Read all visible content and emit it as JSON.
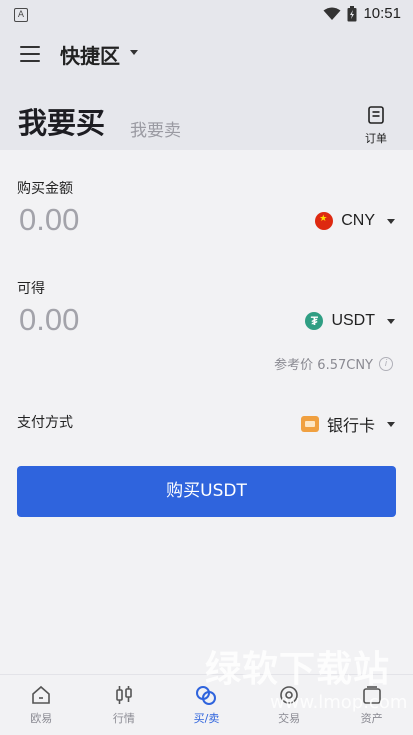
{
  "status_bar": {
    "time": "10:51"
  },
  "header": {
    "zone_title": "快捷区",
    "tabs": {
      "buy": "我要买",
      "sell": "我要卖"
    },
    "orders_label": "订单"
  },
  "form": {
    "purchase_amount": {
      "label": "购买金额",
      "value": "0.00",
      "currency": "CNY"
    },
    "receive": {
      "label": "可得",
      "value": "0.00",
      "currency": "USDT",
      "currency_symbol": "₮"
    },
    "reference_price": "参考价 6.57CNY",
    "payment": {
      "label": "支付方式",
      "method": "银行卡"
    },
    "submit_label": "购买USDT"
  },
  "bottom_nav": [
    {
      "label": "欧易",
      "icon": "home-icon",
      "active": false
    },
    {
      "label": "行情",
      "icon": "candlestick-icon",
      "active": false
    },
    {
      "label": "买/卖",
      "icon": "exchange-icon",
      "active": true
    },
    {
      "label": "交易",
      "icon": "trade-icon",
      "active": false
    },
    {
      "label": "资产",
      "icon": "wallet-icon",
      "active": false
    }
  ],
  "watermark": {
    "text": "绿软下载站",
    "url": "www.lmop.com"
  },
  "colors": {
    "accent": "#2f64dd",
    "header_bg": "#e6e7ec",
    "page_bg": "#f2f2f4",
    "usdt": "#2f9e83"
  }
}
